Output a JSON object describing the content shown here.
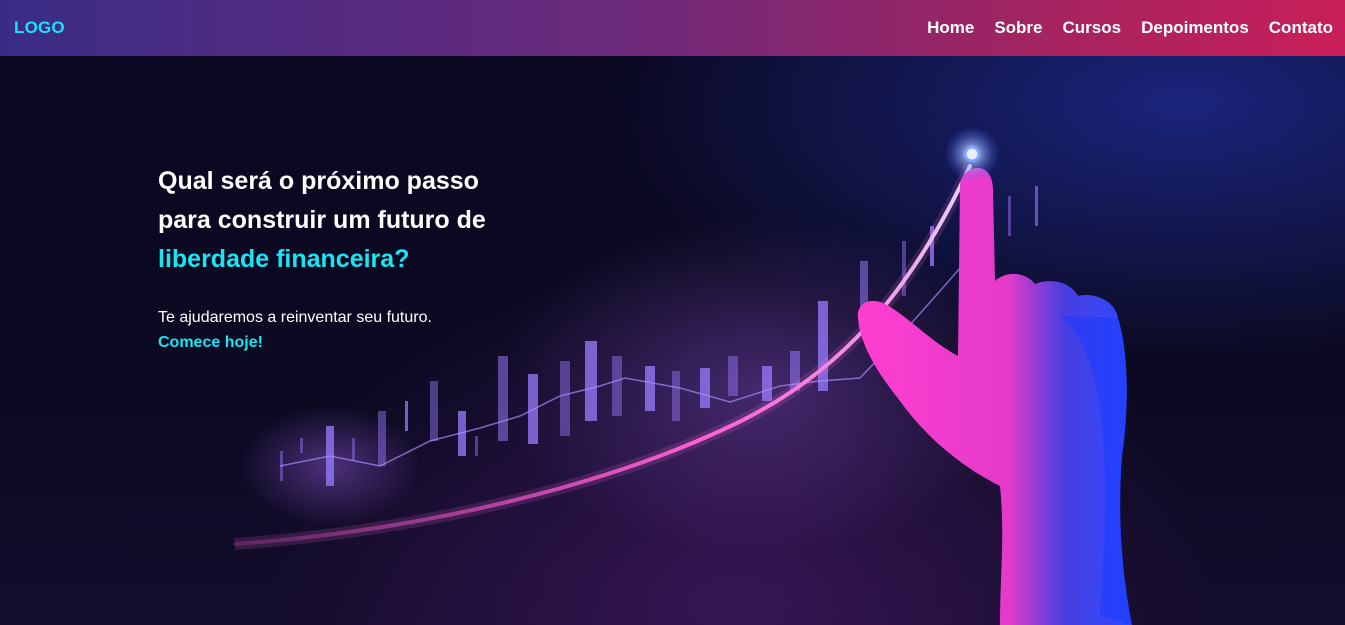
{
  "header": {
    "logo": "LOGO",
    "nav": [
      "Home",
      "Sobre",
      "Cursos",
      "Depoimentos",
      "Contato"
    ]
  },
  "hero": {
    "headline_line1": "Qual será o próximo passo",
    "headline_line2": "para construir um futuro de",
    "headline_highlight": "liberdade financeira?",
    "subtitle": "Te ajudaremos a reinventar seu futuro.",
    "cta": "Comece hoje!"
  },
  "colors": {
    "accent": "#16e6f3",
    "nav_gradient_start": "#3a2c86",
    "nav_gradient_end": "#c81f5a",
    "background": "#06051a"
  },
  "icons": [
    "rising-graph-illustration",
    "pointing-hand-illustration"
  ]
}
